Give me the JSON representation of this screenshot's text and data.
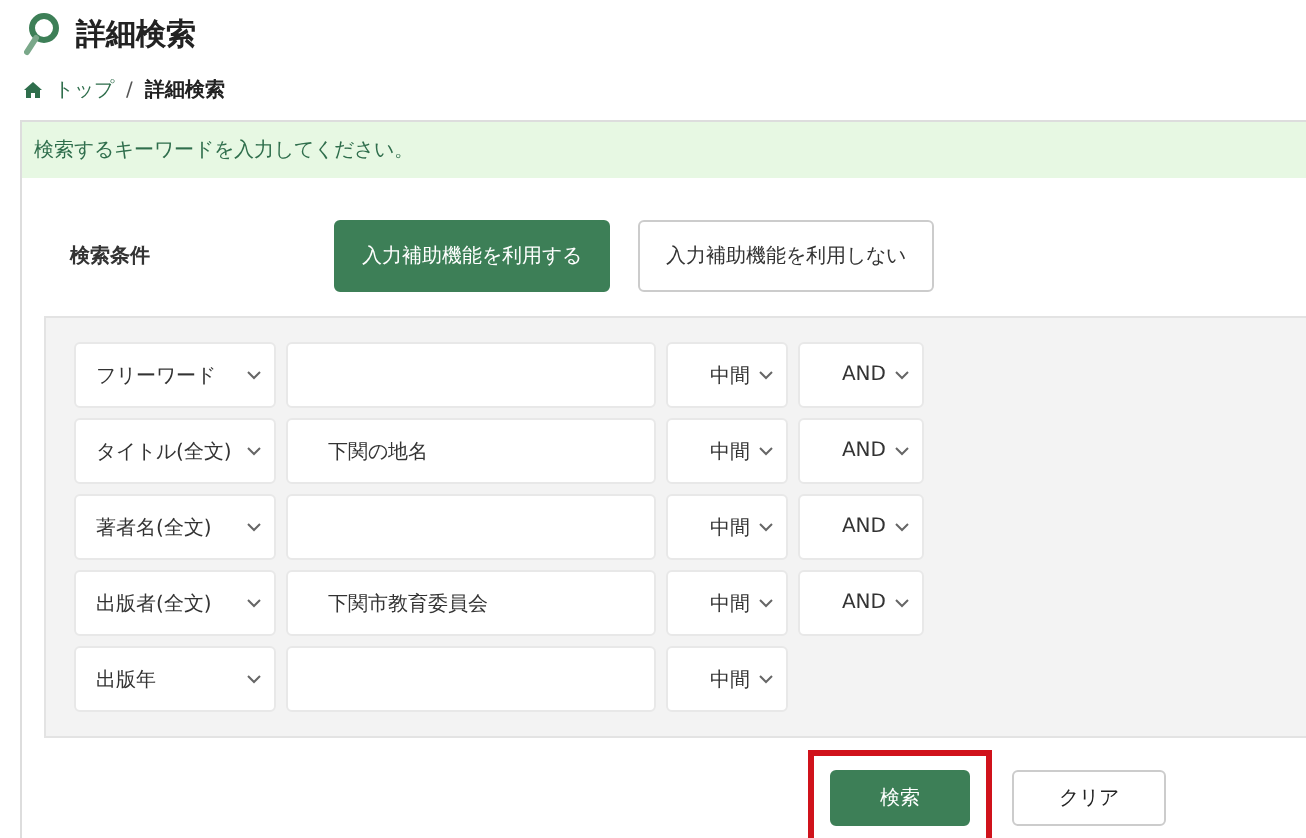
{
  "page_title": "詳細検索",
  "breadcrumb_separator": "/",
  "breadcrumb": [
    {
      "label": "トップ",
      "kind": "link"
    },
    {
      "label": "詳細検索",
      "kind": "current"
    }
  ],
  "message": "検索するキーワードを入力してください。",
  "conditions_label": "検索条件",
  "assist_options": [
    {
      "label": "入力補助機能を利用する",
      "selected": true
    },
    {
      "label": "入力補助機能を利用しない",
      "selected": false
    }
  ],
  "rows": [
    {
      "field": "フリーワード",
      "value": "",
      "match": "中間",
      "operator": "AND"
    },
    {
      "field": "タイトル(全文)",
      "value": "下関の地名",
      "match": "中間",
      "operator": "AND"
    },
    {
      "field": "著者名(全文)",
      "value": "",
      "match": "中間",
      "operator": "AND"
    },
    {
      "field": "出版者(全文)",
      "value": "下関市教育委員会",
      "match": "中間",
      "operator": "AND"
    },
    {
      "field": "出版年",
      "value": "",
      "match": "中間"
    }
  ],
  "buttons": [
    {
      "label": "検索",
      "kind": "primary",
      "highlighted": true
    },
    {
      "label": "クリア",
      "kind": "secondary",
      "highlighted": false
    }
  ]
}
